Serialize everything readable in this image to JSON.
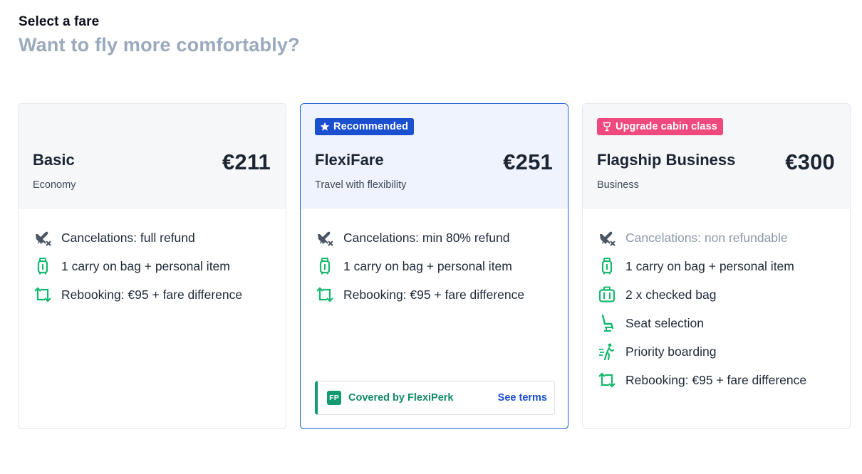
{
  "header": {
    "kicker": "Select a fare",
    "subtitle": "Want to fly more comfortably?"
  },
  "colors": {
    "accent_blue": "#1a4fd0",
    "accent_pink": "#f0497e",
    "icon_green": "#14b86e",
    "perk_green": "#129a72",
    "muted_text": "#9aa9bc"
  },
  "fares": [
    {
      "name": "Basic",
      "subtitle": "Economy",
      "price": "€211",
      "badge": null,
      "features": [
        {
          "icon": "plane-cancel-icon",
          "text": "Cancelations: full refund",
          "muted": false
        },
        {
          "icon": "carry-on-bag-icon",
          "text": "1 carry on bag + personal item",
          "muted": false
        },
        {
          "icon": "rebooking-icon",
          "text": "Rebooking:  €95 + fare difference",
          "muted": false
        }
      ]
    },
    {
      "name": "FlexiFare",
      "subtitle": "Travel with flexibility",
      "price": "€251",
      "badge": {
        "icon": "star-icon",
        "label": "Recommended"
      },
      "selected": true,
      "features": [
        {
          "icon": "plane-cancel-icon",
          "text": "Cancelations: min 80% refund",
          "muted": false
        },
        {
          "icon": "carry-on-bag-icon",
          "text": "1 carry on bag + personal item",
          "muted": false
        },
        {
          "icon": "rebooking-icon",
          "text": "Rebooking:  €95 + fare difference",
          "muted": false
        }
      ],
      "perk": {
        "logo": "FP",
        "text": "Covered by FlexiPerk",
        "link": "See terms"
      }
    },
    {
      "name": "Flagship Business",
      "subtitle": "Business",
      "price": "€300",
      "badge": {
        "icon": "cocktail-glass-icon",
        "label": "Upgrade cabin class"
      },
      "features": [
        {
          "icon": "plane-cancel-icon",
          "text": "Cancelations: non refundable",
          "muted": true
        },
        {
          "icon": "carry-on-bag-icon",
          "text": "1 carry on bag + personal item",
          "muted": false
        },
        {
          "icon": "checked-bag-icon",
          "text": "2 x checked bag",
          "muted": false
        },
        {
          "icon": "seat-icon",
          "text": "Seat selection",
          "muted": false
        },
        {
          "icon": "priority-boarding-icon",
          "text": "Priority boarding",
          "muted": false
        },
        {
          "icon": "rebooking-icon",
          "text": "Rebooking:  €95 + fare difference",
          "muted": false
        }
      ]
    }
  ]
}
